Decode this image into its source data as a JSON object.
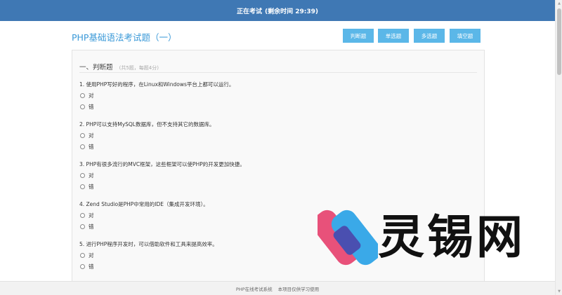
{
  "topbar": {
    "status": "正在考试",
    "remaining": "(剩余时间 29:39)"
  },
  "exam": {
    "title": "PHP基础语法考试题（一）"
  },
  "type_buttons": [
    "判断题",
    "单选题",
    "多选题",
    "填空题"
  ],
  "section": {
    "title": "一、判断题",
    "note": "(共5题，每题4分)"
  },
  "questions": [
    {
      "text": "1. 使用PHP写好的程序，在Linux和Windows平台上都可以运行。",
      "options": [
        "对",
        "错"
      ]
    },
    {
      "text": "2. PHP可以支持MySQL数据库，但不支持其它的数据库。",
      "options": [
        "对",
        "错"
      ]
    },
    {
      "text": "3. PHP有很多流行的MVC框架，这些框架可以使PHP的开发更加快捷。",
      "options": [
        "对",
        "错"
      ]
    },
    {
      "text": "4. Zend Studio是PHP中常用的IDE（集成开发环境）。",
      "options": [
        "对",
        "错"
      ]
    },
    {
      "text": "5. 进行PHP程序开发时，可以借助软件和工具来提高效率。",
      "options": [
        "对",
        "错"
      ]
    }
  ],
  "footer": {
    "system": "PHP在线考试系统",
    "note": "本项目仅供学习使用"
  },
  "watermark": {
    "text": "灵锡网"
  },
  "icons": {
    "scroll_up": "triangle-up-icon",
    "scroll_down": "triangle-down-icon"
  },
  "colors": {
    "topbar": "#3f78b4",
    "title": "#3a99d8",
    "button": "#5bb7e8",
    "logo_pink": "#e8517a",
    "logo_blue": "#3aa9e8"
  }
}
